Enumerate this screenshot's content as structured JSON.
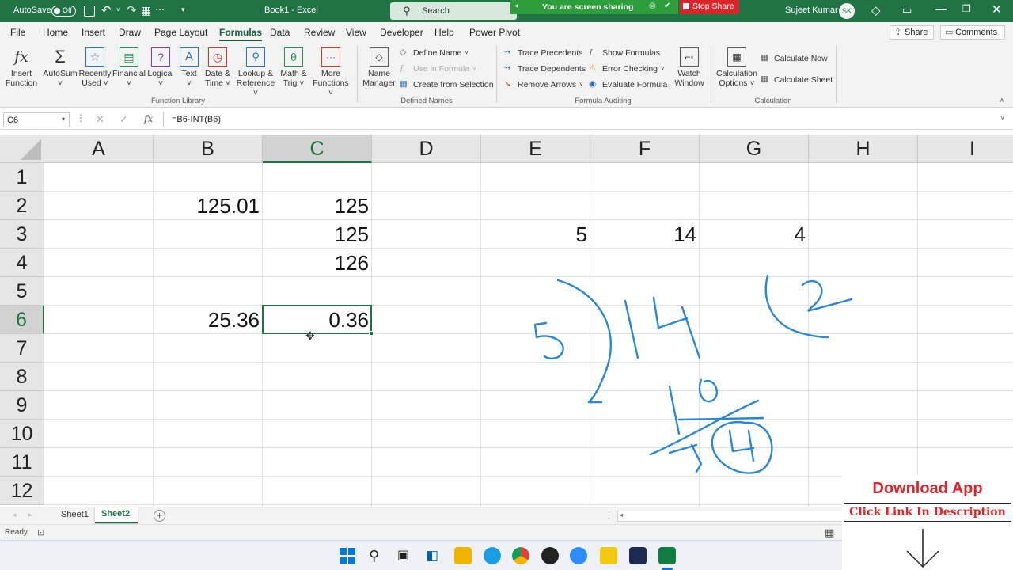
{
  "titlebar": {
    "autosave_label": "AutoSave",
    "autosave_state": "Off",
    "doc_title": "Book1  -  Excel",
    "search_placeholder": "Search",
    "screen_sharing": "You are screen sharing",
    "stop_share": "Stop Share",
    "user_name": "Sujeet Kumar",
    "user_initials": "SK"
  },
  "ribbon_tabs": [
    "File",
    "Home",
    "Insert",
    "Draw",
    "Page Layout",
    "Formulas",
    "Data",
    "Review",
    "View",
    "Developer",
    "Help",
    "Power Pivot"
  ],
  "active_tab": "Formulas",
  "share_label": "Share",
  "comments_label": "Comments",
  "ribbon": {
    "function_library": {
      "label": "Function Library",
      "buttons": [
        {
          "l1": "Insert",
          "l2": "Function"
        },
        {
          "l1": "AutoSum",
          "l2": "˅"
        },
        {
          "l1": "Recently",
          "l2": "Used ˅"
        },
        {
          "l1": "Financial",
          "l2": "˅"
        },
        {
          "l1": "Logical",
          "l2": "˅"
        },
        {
          "l1": "Text",
          "l2": "˅"
        },
        {
          "l1": "Date &",
          "l2": "Time ˅"
        },
        {
          "l1": "Lookup &",
          "l2": "Reference ˅"
        },
        {
          "l1": "Math &",
          "l2": "Trig ˅"
        },
        {
          "l1": "More",
          "l2": "Functions ˅"
        }
      ]
    },
    "defined_names": {
      "label": "Defined Names",
      "name_manager": {
        "l1": "Name",
        "l2": "Manager"
      },
      "define_name": "Define Name",
      "use_in_formula": "Use in Formula",
      "create_from_selection": "Create from Selection"
    },
    "formula_auditing": {
      "label": "Formula Auditing",
      "trace_precedents": "Trace Precedents",
      "trace_dependents": "Trace Dependents",
      "remove_arrows": "Remove Arrows",
      "show_formulas": "Show Formulas",
      "error_checking": "Error Checking",
      "evaluate_formula": "Evaluate Formula",
      "watch_window": {
        "l1": "Watch",
        "l2": "Window"
      }
    },
    "calculation": {
      "label": "Calculation",
      "options": {
        "l1": "Calculation",
        "l2": "Options ˅"
      },
      "calc_now": "Calculate Now",
      "calc_sheet": "Calculate Sheet"
    }
  },
  "formula_bar": {
    "name_box": "C6",
    "fx": "fx",
    "formula": "=B6-INT(B6)"
  },
  "columns": [
    "A",
    "B",
    "C",
    "D",
    "E",
    "F",
    "G",
    "H",
    "I"
  ],
  "rows": [
    "1",
    "2",
    "3",
    "4",
    "5",
    "6",
    "7",
    "8",
    "9",
    "10",
    "11",
    "12"
  ],
  "cells": [
    {
      "col": "B",
      "row": 2,
      "value": "125.01"
    },
    {
      "col": "C",
      "row": 2,
      "value": "125"
    },
    {
      "col": "C",
      "row": 3,
      "value": "125"
    },
    {
      "col": "E",
      "row": 3,
      "value": "5"
    },
    {
      "col": "F",
      "row": 3,
      "value": "14"
    },
    {
      "col": "G",
      "row": 3,
      "value": "4"
    },
    {
      "col": "C",
      "row": 4,
      "value": "126"
    },
    {
      "col": "B",
      "row": 6,
      "value": "25.36"
    },
    {
      "col": "C",
      "row": 6,
      "value": "0.36"
    }
  ],
  "selected_cell": {
    "col": "C",
    "row": 6
  },
  "sheets": [
    "Sheet1",
    "Sheet2"
  ],
  "active_sheet": "Sheet2",
  "status": {
    "ready": "Ready"
  },
  "promo": {
    "download": "Download App",
    "click": "Click Link In Description"
  },
  "colors": {
    "excel_green": "#217346",
    "selection_green": "#1e7145",
    "ink_blue": "#2f86c8",
    "stop_red": "#d9262c"
  }
}
